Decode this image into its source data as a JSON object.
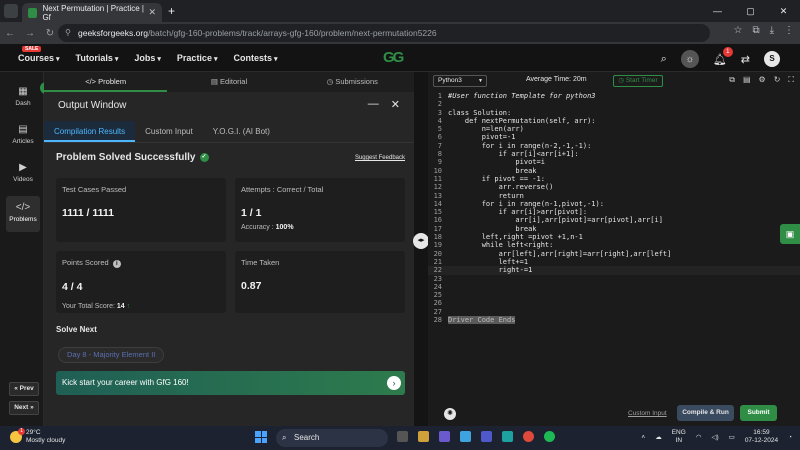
{
  "browser": {
    "tab_title": "Next Permutation | Practice | Gf",
    "url_domain": "geeksforgeeks.org",
    "url_path": "/batch/gfg-160-problems/track/arrays-gfg-160/problem/next-permutation5226"
  },
  "header": {
    "sale_badge": "SALE",
    "menu": [
      "Courses",
      "Tutorials",
      "Jobs",
      "Practice",
      "Contests"
    ],
    "logo_text": "GG",
    "notification_count": "1",
    "avatar_letter": "S"
  },
  "leftnav": {
    "items": [
      "Dash",
      "Articles",
      "Videos",
      "Problems"
    ],
    "prev_label": "« Prev",
    "next_label": "Next »"
  },
  "problem_tabs": [
    "Problem",
    "Editorial",
    "Submissions"
  ],
  "output": {
    "title": "Output Window",
    "subtabs": [
      "Compilation Results",
      "Custom Input",
      "Y.O.G.I. (AI Bot)"
    ],
    "status": "Problem Solved Successfully",
    "feedback_link": "Suggest Feedback",
    "test_cases_label": "Test Cases Passed",
    "test_cases_value": "1111 / 1111",
    "attempts_label": "Attempts : Correct / Total",
    "attempts_value": "1 / 1",
    "accuracy_label": "Accuracy :",
    "accuracy_value": "100%",
    "points_label": "Points Scored",
    "points_value": "4 / 4",
    "total_score_label": "Your Total Score:",
    "total_score_value": "14",
    "time_label": "Time Taken",
    "time_value": "0.87",
    "solve_next_heading": "Solve Next",
    "solve_next_pill": "Day 8 - Majority Element II",
    "banner_text": "Kick start your career with GfG 160!"
  },
  "editor": {
    "language": "Python3",
    "average_time": "Average Time: 20m",
    "timer_label": "Start Timer",
    "custom_input": "Custom Input",
    "compile_label": "Compile & Run",
    "submit_label": "Submit",
    "code_lines": [
      "#User function Template for python3",
      "",
      "class Solution:",
      "    def nextPermutation(self, arr):",
      "        n=len(arr)",
      "        pivot=-1",
      "        for i in range(n-2,-1,-1):",
      "            if arr[i]<arr[i+1]:",
      "                pivot=i",
      "                break",
      "        if pivot == -1:",
      "            arr.reverse()",
      "            return",
      "        for i in range(n-1,pivot,-1):",
      "            if arr[i]>arr[pivot]:",
      "                arr[i],arr[pivot]=arr[pivot],arr[i]",
      "                break",
      "        left,right =pivot +1,n-1",
      "        while left<right:",
      "            arr[left],arr[right]=arr[right],arr[left]",
      "            left+=1",
      "            right-=1",
      "",
      "",
      "",
      "",
      "",
      "Driver Code Ends"
    ]
  },
  "taskbar": {
    "temperature": "29°C",
    "weather": "Mostly cloudy",
    "weather_badge": "1",
    "search_label": "Search",
    "lang_top": "ENG",
    "lang_bottom": "IN",
    "time": "16:59",
    "date": "07-12-2024"
  }
}
